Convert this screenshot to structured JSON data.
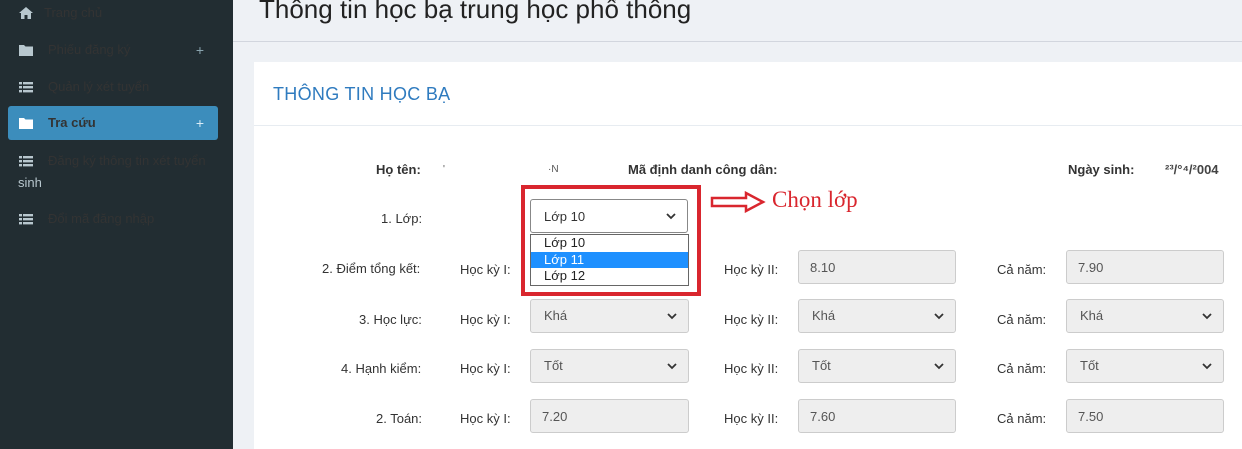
{
  "sidebar": {
    "items": [
      {
        "label": "Trang chủ",
        "icon": "home-icon"
      },
      {
        "label": "Phiếu đăng ký",
        "icon": "folder-icon",
        "expand": "+"
      },
      {
        "label": "Quản lý xét tuyển",
        "icon": "list-icon"
      },
      {
        "label": "Tra cứu",
        "icon": "folder-icon",
        "expand": "+"
      },
      {
        "label": "Đăng ký thông tin xét tuyển",
        "label_line2": "sinh",
        "icon": "list-icon"
      },
      {
        "label": "Đổi mã đăng nhập",
        "icon": "list-icon"
      }
    ]
  },
  "header": {
    "title": "Thông tin học bạ trung học phổ thông"
  },
  "panel": {
    "title": "THÔNG TIN HỌC BẠ",
    "personal": {
      "name_label": "Họ tên:",
      "name_value_fragment_1": "'",
      "name_value_fragment_2": "·N",
      "id_label": "Mã định danh công dân:",
      "dob_label": "Ngày sinh:",
      "dob_value": "²³/°⁴/²004"
    },
    "class_row": {
      "label": "1. Lớp:",
      "selected": "Lớp 10",
      "options": [
        "Lớp 10",
        "Lớp 11",
        "Lớp 12"
      ],
      "highlighted_option": "Lớp 11"
    },
    "labels": {
      "hk1": "Học kỳ I:",
      "hk2": "Học kỳ II:",
      "ca_nam": "Cả năm:"
    },
    "rows": [
      {
        "label": "2. Điểm tổng kết:",
        "hk1": "",
        "hk2": "8.10",
        "ca_nam": "7.90",
        "type": "input"
      },
      {
        "label": "3. Học lực:",
        "hk1": "Khá",
        "hk2": "Khá",
        "ca_nam": "Khá",
        "type": "select"
      },
      {
        "label": "4. Hạnh kiểm:",
        "hk1": "Tốt",
        "hk2": "Tốt",
        "ca_nam": "Tốt",
        "type": "select"
      },
      {
        "label": "2. Toán:",
        "hk1": "7.20",
        "hk2": "7.60",
        "ca_nam": "7.50",
        "type": "input"
      }
    ]
  },
  "annotation": {
    "text": "Chọn lớp",
    "color": "#d9262e"
  },
  "colors": {
    "sidebar_bg": "#222d32",
    "active_bg": "#3c8dbc",
    "title_blue": "#2f7bbf",
    "dropdown_highlight": "#1e90ff"
  }
}
